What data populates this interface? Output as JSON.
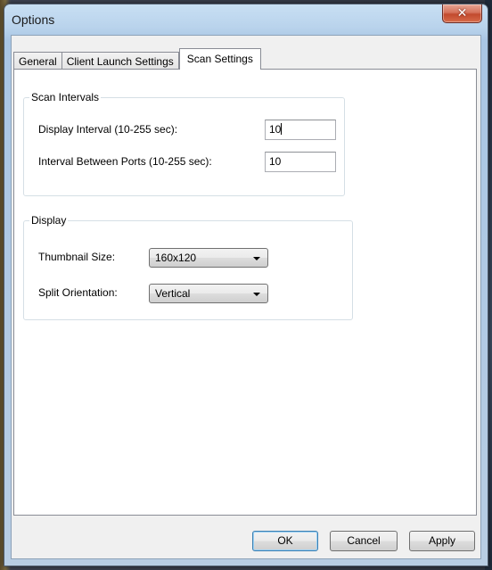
{
  "window": {
    "title": "Options",
    "close_glyph": "✕"
  },
  "tabs": [
    {
      "label": "General",
      "selected": false
    },
    {
      "label": "Client Launch Settings",
      "selected": false
    },
    {
      "label": "Scan Settings",
      "selected": true
    }
  ],
  "scan_intervals": {
    "group_label": "Scan Intervals",
    "display_interval_label": "Display Interval (10-255 sec):",
    "display_interval_value": "10",
    "port_interval_label": "Interval Between Ports (10-255 sec):",
    "port_interval_value": "10"
  },
  "display": {
    "group_label": "Display",
    "thumbnail_label": "Thumbnail Size:",
    "thumbnail_value": "160x120",
    "split_label": "Split Orientation:",
    "split_value": "Vertical"
  },
  "buttons": {
    "ok": "OK",
    "cancel": "Cancel",
    "apply": "Apply"
  },
  "colors": {
    "close_button": "#c24a2e",
    "title_bar": "#b9d3ec",
    "panel": "#ffffff"
  }
}
